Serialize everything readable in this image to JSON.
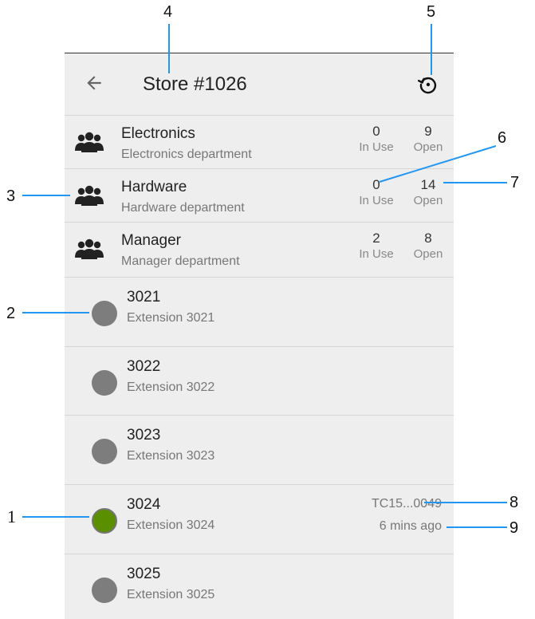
{
  "header": {
    "title": "Store #1026",
    "back_icon": "arrow-back-icon",
    "refresh_icon": "refresh-icon"
  },
  "departments": [
    {
      "name": "Electronics",
      "description": "Electronics department",
      "in_use": "0",
      "in_use_label": "In Use",
      "open": "9",
      "open_label": "Open"
    },
    {
      "name": "Hardware",
      "description": "Hardware department",
      "in_use": "0",
      "in_use_label": "In Use",
      "open": "14",
      "open_label": "Open"
    },
    {
      "name": "Manager",
      "description": "Manager department",
      "in_use": "2",
      "in_use_label": "In Use",
      "open": "8",
      "open_label": "Open"
    }
  ],
  "extensions": [
    {
      "number": "3021",
      "description": "Extension 3021",
      "status": "inactive"
    },
    {
      "number": "3022",
      "description": "Extension 3022",
      "status": "inactive"
    },
    {
      "number": "3023",
      "description": "Extension 3023",
      "status": "inactive"
    },
    {
      "number": "3024",
      "description": "Extension 3024",
      "status": "active",
      "device": "TC15...0049",
      "last_seen": "6 mins ago"
    },
    {
      "number": "3025",
      "description": "Extension 3025",
      "status": "inactive"
    }
  ],
  "callouts": {
    "n1": "1",
    "n2": "2",
    "n3": "3",
    "n4": "4",
    "n5": "5",
    "n6": "6",
    "n7": "7",
    "n8": "8",
    "n9": "9"
  },
  "colors": {
    "background": "#eeeeee",
    "divider": "#d6d6d6",
    "callout_line": "#2196f3",
    "status_active": "#5a8f00",
    "status_inactive": "#7d7d7d"
  }
}
